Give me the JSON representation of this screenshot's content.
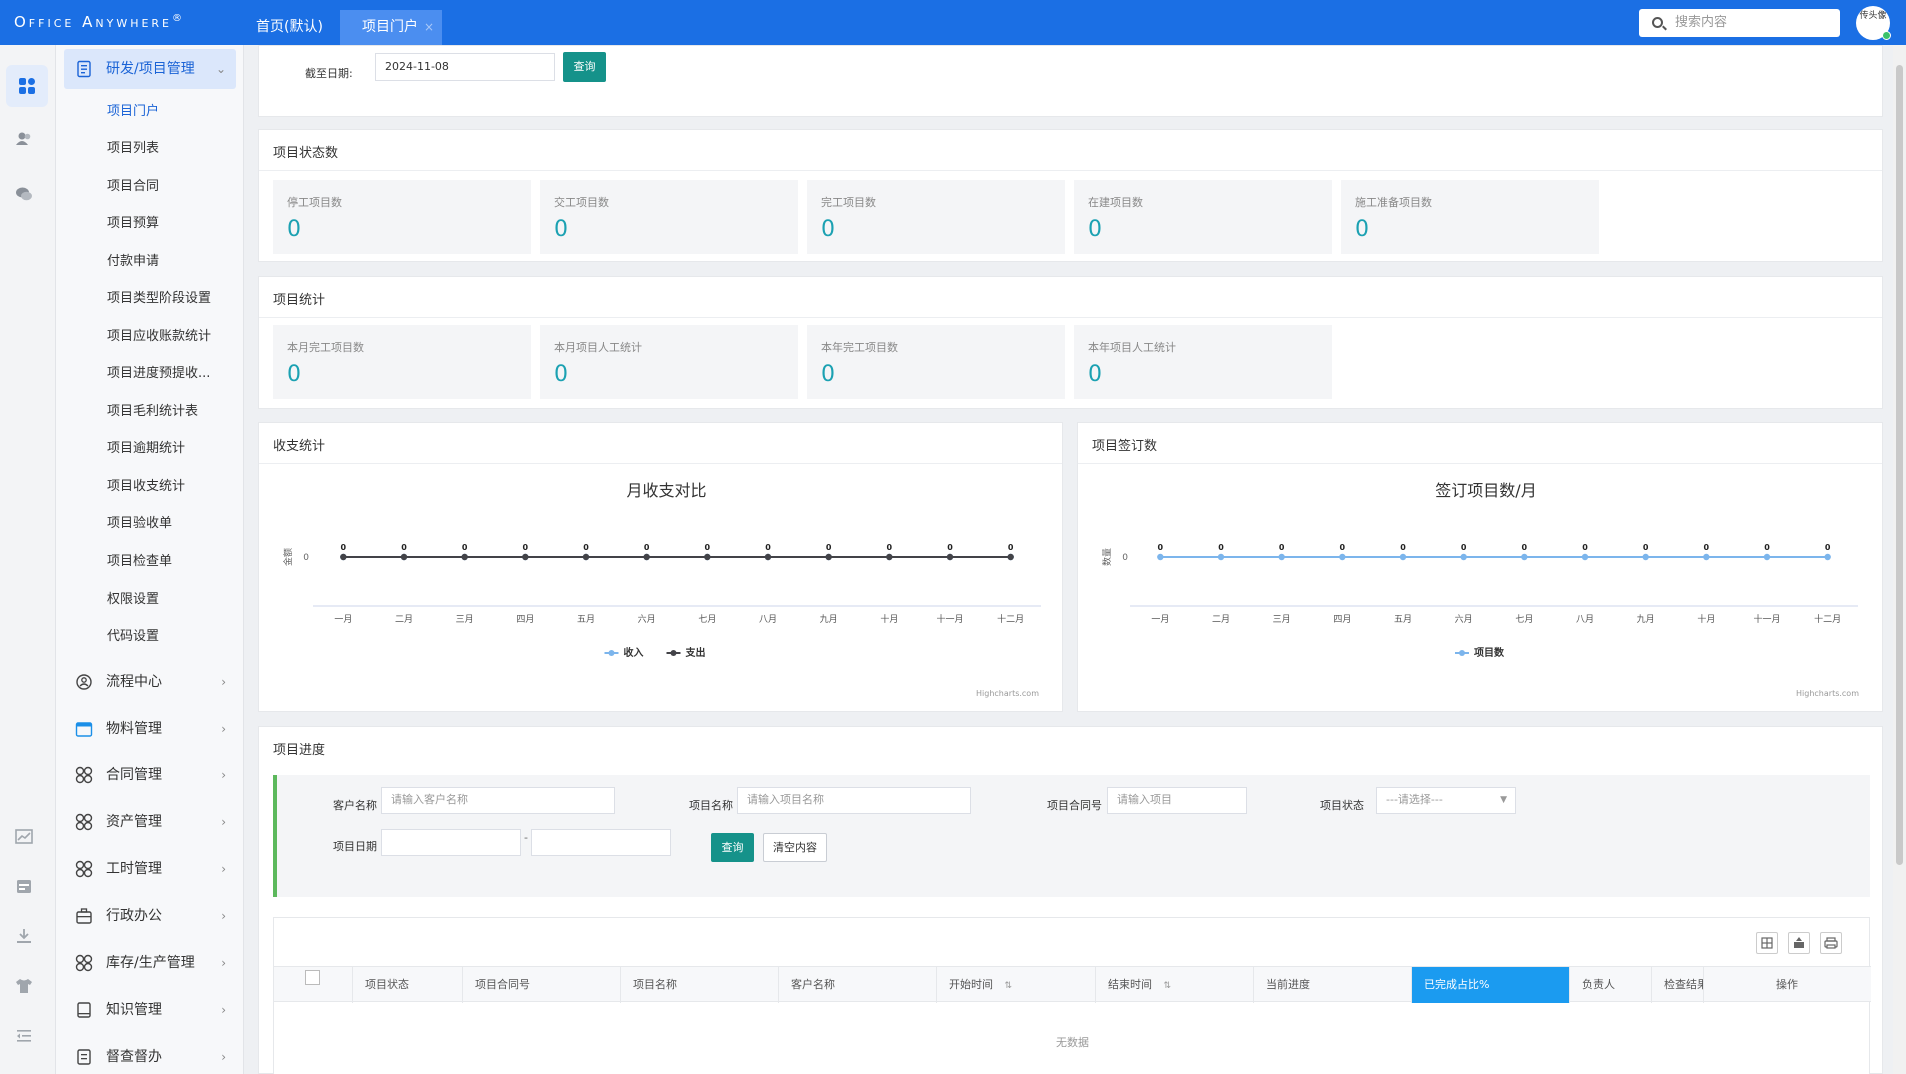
{
  "topbar": {
    "logo": "Office Anywhere",
    "logo_mark": "®",
    "tabs": [
      {
        "label": "首页(默认)"
      },
      {
        "label": "项目门户",
        "active": true,
        "close": "×"
      }
    ],
    "search_placeholder": "搜索内容",
    "avatar_text": "传头像",
    "brand_color": "#1b6fe4"
  },
  "rail_icons": [
    "apps-icon",
    "contacts-icon",
    "chat-icon",
    "chart-icon",
    "calendar-icon",
    "download-icon",
    "shirt-icon",
    "collapse-icon"
  ],
  "menu": {
    "open_group": {
      "label": "研发/项目管理",
      "icon": "document-icon"
    },
    "items": [
      {
        "label": "项目门户",
        "active": true
      },
      {
        "label": "项目列表"
      },
      {
        "label": "项目合同"
      },
      {
        "label": "项目预算"
      },
      {
        "label": "付款申请"
      },
      {
        "label": "项目类型阶段设置"
      },
      {
        "label": "项目应收账款统计"
      },
      {
        "label": "项目进度预提收..."
      },
      {
        "label": "项目毛利统计表"
      },
      {
        "label": "项目逾期统计"
      },
      {
        "label": "项目收支统计"
      },
      {
        "label": "项目验收单"
      },
      {
        "label": "项目检查单"
      },
      {
        "label": "权限设置"
      },
      {
        "label": "代码设置"
      }
    ],
    "groups": [
      {
        "label": "流程中心",
        "icon": "flow-icon"
      },
      {
        "label": "物料管理",
        "icon": "box-icon"
      },
      {
        "label": "合同管理",
        "icon": "grid-icon"
      },
      {
        "label": "资产管理",
        "icon": "grid-icon"
      },
      {
        "label": "工时管理",
        "icon": "grid-icon"
      },
      {
        "label": "行政办公",
        "icon": "briefcase-icon"
      },
      {
        "label": "库存/生产管理",
        "icon": "grid-icon"
      },
      {
        "label": "知识管理",
        "icon": "book-icon"
      },
      {
        "label": "督查督办",
        "icon": "checklist-icon"
      }
    ]
  },
  "filter": {
    "date_label": "截至日期:",
    "date_value": "2024-11-08",
    "query_label": "查询"
  },
  "status_card": {
    "title": "项目状态数",
    "stats": [
      {
        "label": "停工项目数",
        "value": "0"
      },
      {
        "label": "交工项目数",
        "value": "0"
      },
      {
        "label": "完工项目数",
        "value": "0"
      },
      {
        "label": "在建项目数",
        "value": "0"
      },
      {
        "label": "施工准备项目数",
        "value": "0"
      }
    ]
  },
  "stats_card": {
    "title": "项目统计",
    "stats": [
      {
        "label": "本月完工项目数",
        "value": "0"
      },
      {
        "label": "本月项目人工统计",
        "value": "0"
      },
      {
        "label": "本年完工项目数",
        "value": "0"
      },
      {
        "label": "本年项目人工统计",
        "value": "0"
      }
    ]
  },
  "income_card": {
    "title": "收支统计"
  },
  "signed_card": {
    "title": "项目签订数"
  },
  "chart_data": [
    {
      "type": "line",
      "title": "月收支对比",
      "ylabel": "金额",
      "categories": [
        "一月",
        "二月",
        "三月",
        "四月",
        "五月",
        "六月",
        "七月",
        "八月",
        "九月",
        "十月",
        "十一月",
        "十二月"
      ],
      "yticks": [
        "0"
      ],
      "series": [
        {
          "name": "收入",
          "values": [
            0,
            0,
            0,
            0,
            0,
            0,
            0,
            0,
            0,
            0,
            0,
            0
          ],
          "color": "#7cb5ec"
        },
        {
          "name": "支出",
          "values": [
            0,
            0,
            0,
            0,
            0,
            0,
            0,
            0,
            0,
            0,
            0,
            0
          ],
          "color": "#434348"
        }
      ],
      "legend": "bottom-center",
      "credit": "Highcharts.com"
    },
    {
      "type": "line",
      "title": "签订项目数/月",
      "ylabel": "数量",
      "categories": [
        "一月",
        "二月",
        "三月",
        "四月",
        "五月",
        "六月",
        "七月",
        "八月",
        "九月",
        "十月",
        "十一月",
        "十二月"
      ],
      "yticks": [
        "0"
      ],
      "series": [
        {
          "name": "项目数",
          "values": [
            0,
            0,
            0,
            0,
            0,
            0,
            0,
            0,
            0,
            0,
            0,
            0
          ],
          "color": "#7cb5ec"
        }
      ],
      "legend": "bottom-center",
      "credit": "Highcharts.com"
    }
  ],
  "progress": {
    "title": "项目进度",
    "customer_label": "客户名称",
    "customer_placeholder": "请输入客户名称",
    "project_label": "项目名称",
    "project_placeholder": "请输入项目名称",
    "contract_label": "项目合同号",
    "contract_placeholder": "请输入项目",
    "status_label": "项目状态",
    "status_value": "---请选择---",
    "date_label": "项目日期",
    "date_sep": "-",
    "query_label": "查询",
    "clear_label": "清空内容",
    "columns": [
      "项目状态",
      "项目合同号",
      "项目名称",
      "客户名称",
      "开始时间",
      "结束时间",
      "当前进度",
      "已完成占比%",
      "负责人",
      "检查结果",
      "操作"
    ],
    "empty_text": "无数据"
  }
}
